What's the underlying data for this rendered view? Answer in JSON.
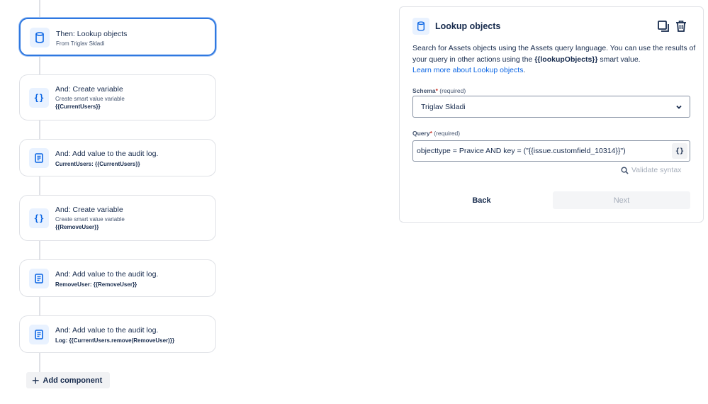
{
  "flow": {
    "cards": [
      {
        "title": "Then: Lookup objects",
        "sub": "From Triglav Skladi",
        "icon": "database-icon"
      },
      {
        "title": "And: Create variable",
        "sub": "Create smart value variable",
        "bold": "{{CurrentUsers}}",
        "icon": "braces-icon"
      },
      {
        "title": "And: Add value to the audit log.",
        "bold": "CurrentUsers: {{CurrentUsers}}",
        "icon": "audit-log-icon"
      },
      {
        "title": "And: Create variable",
        "sub": "Create smart value variable",
        "bold": "{{RemoveUser}}",
        "icon": "braces-icon"
      },
      {
        "title": "And: Add value to the audit log.",
        "bold": "RemoveUser: {{RemoveUser}}",
        "icon": "audit-log-icon"
      },
      {
        "title": "And: Add value to the audit log.",
        "bold": "Log: {{CurrentUsers.remove(RemoveUser)}}",
        "icon": "audit-log-icon"
      }
    ],
    "add_component_label": "Add component"
  },
  "panel": {
    "title": "Lookup objects",
    "desc_part1": "Search for Assets objects using the Assets query language. You can use the results of your query in other actions using the ",
    "desc_smart_value": "{{lookupObjects}}",
    "desc_part2": " smart value.",
    "learn_more": "Learn more about Lookup objects",
    "learn_more_end": ".",
    "schema_label": "Schema",
    "schema_required": "(required)",
    "schema_value": "Triglav Skladi",
    "query_label": "Query",
    "query_required": "(required)",
    "query_value": "objecttype = Pravice AND key = (\"{{issue.customfield_10314}}\")",
    "smart_value_button": "{}",
    "validate_label": "Validate syntax",
    "back_label": "Back",
    "next_label": "Next"
  },
  "colors": {
    "accent": "#0c66e4",
    "selected_border": "#2f78e0",
    "required_star": "#c9372c"
  }
}
